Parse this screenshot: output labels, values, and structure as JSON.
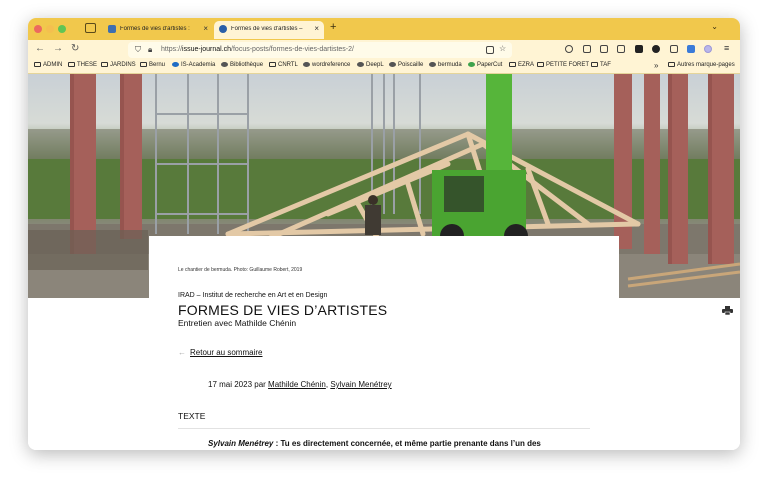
{
  "browser": {
    "tabs": [
      {
        "label": "Formes de vies d'artistes :",
        "active": false
      },
      {
        "label": "Formes de vies d'artistes – ISSU",
        "active": true
      }
    ],
    "close_glyph": "×",
    "new_tab_glyph": "+",
    "tab_list_glyph": "⌄",
    "url_host": "issue-journal.ch",
    "url_prefix": "https://",
    "url_path": "/focus-posts/formes-de-vies-dartistes-2/",
    "nav": {
      "back": "←",
      "forward": "→",
      "reload": "↻"
    },
    "menu_glyph": "≡"
  },
  "bookmarks": {
    "items": [
      {
        "label": "ADMIN",
        "icon": "folder-icon"
      },
      {
        "label": "THESE",
        "icon": "folder-icon"
      },
      {
        "label": "JARDINS",
        "icon": "folder-icon"
      },
      {
        "label": "Bernu",
        "icon": "folder-icon"
      },
      {
        "label": "IS-Academia",
        "icon": "site-icon"
      },
      {
        "label": "Bibliothèque",
        "icon": "site-icon"
      },
      {
        "label": "CNRTL",
        "icon": "folder-icon"
      },
      {
        "label": "wordreference",
        "icon": "site-icon"
      },
      {
        "label": "DeepL",
        "icon": "site-icon"
      },
      {
        "label": "Poiscaille",
        "icon": "site-icon"
      },
      {
        "label": "bermuda",
        "icon": "site-icon"
      },
      {
        "label": "PaperCut",
        "icon": "site-icon"
      },
      {
        "label": "EZRA",
        "icon": "folder-icon"
      },
      {
        "label": "PETITE FORET",
        "icon": "folder-icon"
      },
      {
        "label": "TAF",
        "icon": "folder-icon"
      }
    ],
    "more_glyph": "»",
    "other": "Autres marque-pages"
  },
  "article": {
    "caption": "Le chantier de bermuda. Photo: Guillaume Robert, 2019",
    "institute": "IRAD – Institut de recherche en Art et en Design",
    "title": "FORMES DE VIES D’ARTISTES",
    "subtitle": "Entretien avec Mathilde Chénin",
    "back_arrow": "←",
    "back_link": "Retour au sommaire",
    "date_prefix": "17 mai 2023 par ",
    "author1": "Mathilde Chénin",
    "author_sep": ", ",
    "author2": "Sylvain Menétrey",
    "section": "TEXTE",
    "speaker": "Sylvain Menétrey",
    "first_line": " : Tu es directement concernée, et même partie prenante dans l’un des"
  }
}
